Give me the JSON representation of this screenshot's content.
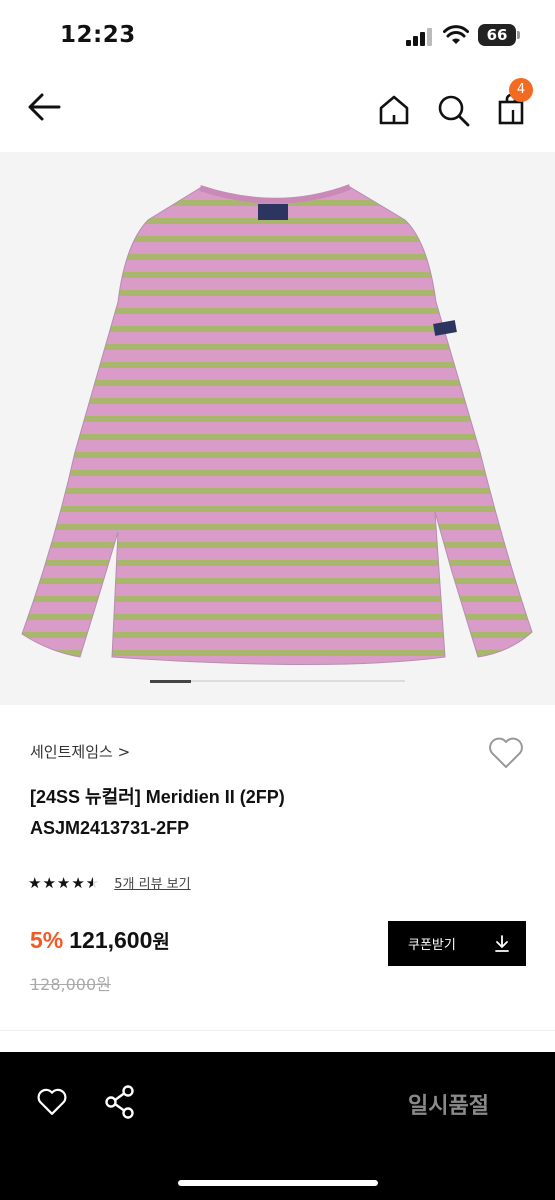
{
  "status_bar": {
    "time": "12:23",
    "battery": "66"
  },
  "nav": {
    "cart_count": "4",
    "back_icon": "arrow-left-icon",
    "home_icon": "home-icon",
    "search_icon": "search-icon",
    "bag_icon": "shopping-bag-icon"
  },
  "gallery": {
    "current_index": 1,
    "progress_fraction": 0.16,
    "shirt_colors": {
      "pink": "#d998c6",
      "green": "#a8b86b"
    }
  },
  "product": {
    "brand": "세인트제임스 >",
    "title_line1": "[24SS 뉴컬러] Meridien II (2FP)",
    "title_line2": "ASJM2413731-2FP",
    "rating": 4.5,
    "review_link": "5개 리뷰 보기",
    "discount": "5%",
    "price": "121,600",
    "price_unit": "원",
    "original_price": "128,000원",
    "coupon_label": "쿠폰받기"
  },
  "bottom_bar": {
    "status_label": "일시품절"
  },
  "colors": {
    "accent": "#f15a24",
    "badge": "#f26b21"
  }
}
